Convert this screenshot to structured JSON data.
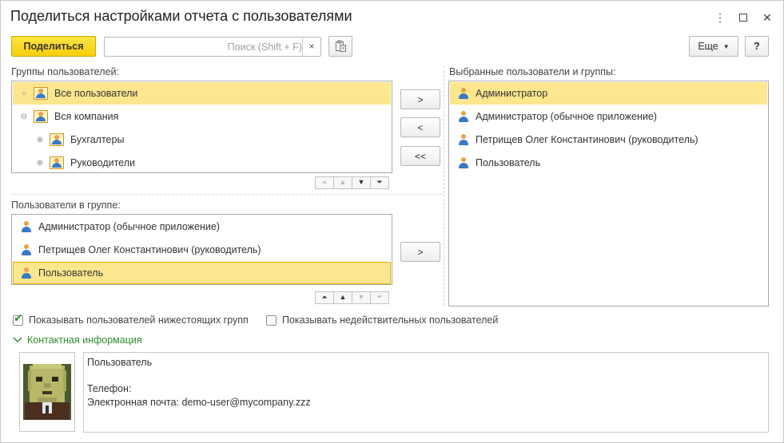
{
  "window": {
    "title": "Поделиться настройками отчета с пользователями",
    "menu_icon": "vertical-dots-icon",
    "maximize_icon": "maximize-icon",
    "close_icon": "close-icon"
  },
  "toolbar": {
    "share_label": "Поделиться",
    "search_placeholder": "Поиск (Shift + F)",
    "clear_label": "×",
    "more_label": "Еще",
    "help_label": "?"
  },
  "groups": {
    "label": "Группы пользователей:",
    "items": [
      {
        "label": "Все пользователи",
        "toggle": "○",
        "selected": true
      },
      {
        "label": "Вся компания",
        "toggle": "⊖",
        "selected": false
      },
      {
        "label": "Бухгалтеры",
        "toggle": "⊕",
        "selected": false
      },
      {
        "label": "Руководители",
        "toggle": "⊕",
        "selected": false
      }
    ]
  },
  "group_users": {
    "label": "Пользователи в группе:",
    "items": [
      {
        "label": "Администратор (обычное приложение)",
        "selected": false
      },
      {
        "label": "Петрищев Олег Константинович (руководитель)",
        "selected": false
      },
      {
        "label": "Пользователь",
        "selected": true
      }
    ]
  },
  "selected": {
    "label": "Выбранные пользователи и группы:",
    "items": [
      {
        "label": "Администратор",
        "selected": true
      },
      {
        "label": "Администратор (обычное приложение)",
        "selected": false
      },
      {
        "label": "Петрищев Олег Константинович (руководитель)",
        "selected": false
      },
      {
        "label": "Пользователь",
        "selected": false
      }
    ]
  },
  "buttons": {
    "add": ">",
    "remove": "<",
    "remove_all": "<<",
    "add_user": ">"
  },
  "options": {
    "show_subgroups_label": "Показывать пользователей нижестоящих групп",
    "show_subgroups_checked": true,
    "show_invalid_label": "Показывать недействительных пользователей",
    "show_invalid_checked": false
  },
  "contact": {
    "header": "Контактная информация",
    "text": "Пользователь\n\nТелефон:\nЭлектронная почта: demo-user@mycompany.zzz"
  }
}
